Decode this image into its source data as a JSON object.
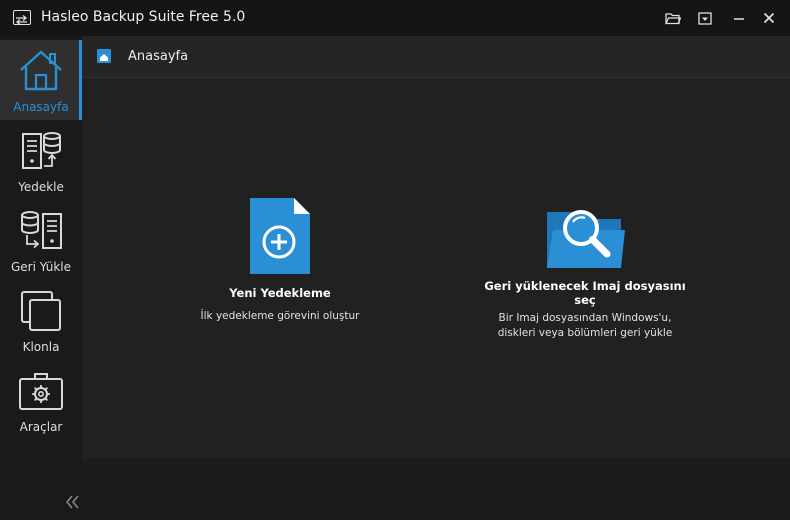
{
  "window": {
    "title": "Hasleo Backup Suite Free 5.0",
    "controls": [
      "open-folder-icon",
      "menu-dropdown-icon",
      "minimize-icon",
      "close-icon"
    ]
  },
  "sidebar": {
    "items": [
      {
        "label": "Anasayfa",
        "icon": "home-icon",
        "active": true
      },
      {
        "label": "Yedekle",
        "icon": "backup-icon",
        "active": false
      },
      {
        "label": "Geri Yükle",
        "icon": "restore-icon",
        "active": false
      },
      {
        "label": "Klonla",
        "icon": "clone-icon",
        "active": false
      },
      {
        "label": "Araçlar",
        "icon": "toolbox-icon",
        "active": false
      }
    ],
    "collapse_glyph": "«"
  },
  "breadcrumb": {
    "label": "Anasayfa",
    "icon": "home-icon"
  },
  "main": {
    "cards": [
      {
        "title": "Yeni Yedekleme",
        "desc": "İlk yedekleme görevini oluştur",
        "icon": "new-backup-icon"
      },
      {
        "title_line1": "Geri yüklenecek Imaj dosyasını",
        "title_line2": "seç",
        "desc_line1": "Bir Imaj dosyasından Windows'u,",
        "desc_line2": "diskleri veya bölümleri geri yükle",
        "icon": "folder-search-icon"
      }
    ]
  },
  "colors": {
    "accent": "#2b8fd6",
    "titlebar": "#151515",
    "sidebar": "#1a1a1a",
    "main": "#212121"
  }
}
